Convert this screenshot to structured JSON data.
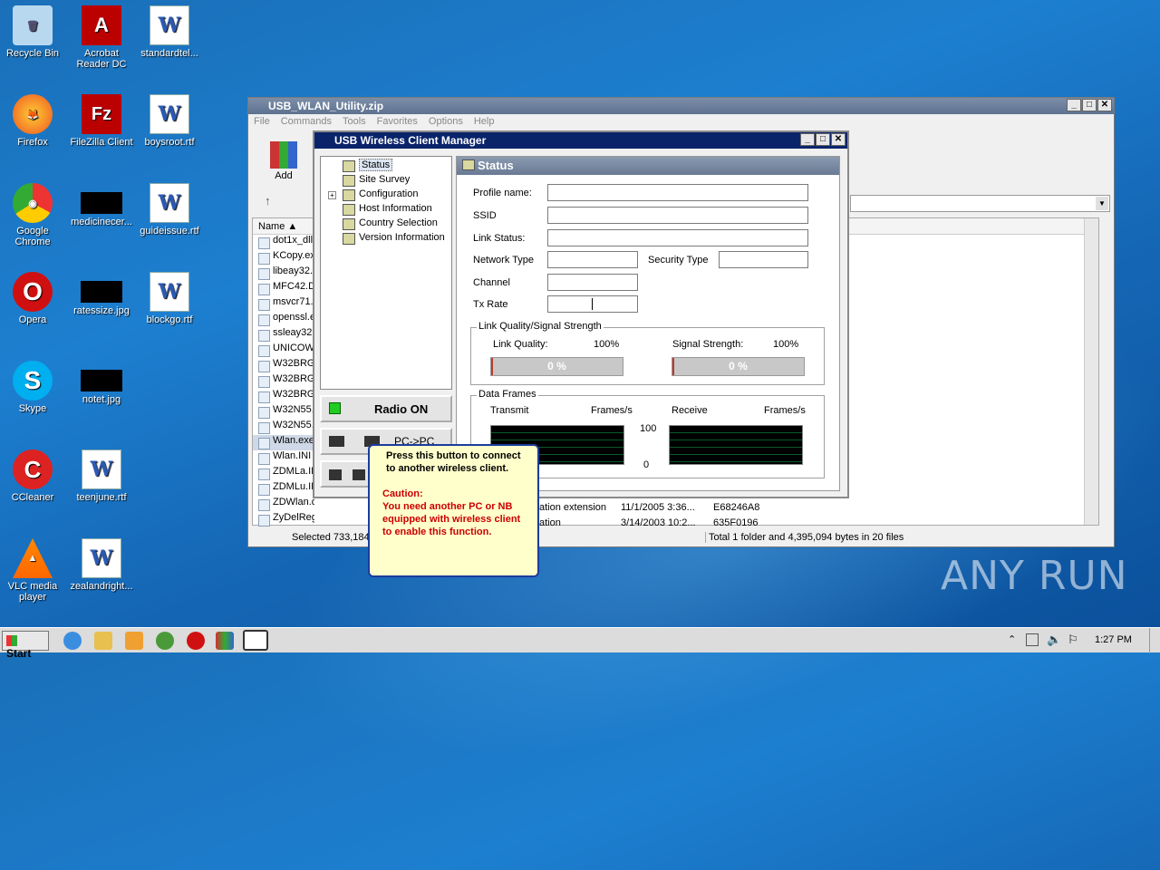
{
  "desktop": {
    "icons": [
      {
        "label": "Recycle Bin",
        "glyph": "🗑"
      },
      {
        "label": "Acrobat Reader DC",
        "glyph": "A"
      },
      {
        "label": "standardtel...",
        "glyph": "W"
      },
      {
        "label": "Firefox",
        "glyph": "🦊"
      },
      {
        "label": "FileZilla Client",
        "glyph": "Fz"
      },
      {
        "label": "boysroot.rtf",
        "glyph": "W"
      },
      {
        "label": "Google Chrome",
        "glyph": "◉"
      },
      {
        "label": "medicinecer...",
        "glyph": ""
      },
      {
        "label": "guideissue.rtf",
        "glyph": "W"
      },
      {
        "label": "Opera",
        "glyph": "O"
      },
      {
        "label": "ratessize.jpg",
        "glyph": ""
      },
      {
        "label": "blockgo.rtf",
        "glyph": "W"
      },
      {
        "label": "Skype",
        "glyph": "S"
      },
      {
        "label": "notet.jpg",
        "glyph": ""
      },
      {
        "label": "CCleaner",
        "glyph": "C"
      },
      {
        "label": "teenjune.rtf",
        "glyph": "W"
      },
      {
        "label": "VLC media player",
        "glyph": "▲"
      },
      {
        "label": "zealandright...",
        "glyph": "W"
      }
    ]
  },
  "winrar": {
    "title": "USB_WLAN_Utility.zip",
    "menu": [
      "File",
      "Commands",
      "Tools",
      "Favorites",
      "Options",
      "Help"
    ],
    "add_label": "Add",
    "column_name": "Name",
    "files": [
      "dot1x_dll",
      "KCopy.ex",
      "libeay32.",
      "MFC42.D",
      "msvcr71.",
      "openssl.e",
      "ssleay32",
      "UNICOW",
      "W32BRG",
      "W32BRG",
      "W32BRG",
      "W32N55.",
      "W32N55.",
      "Wlan.exe",
      "Wlan.INI",
      "ZDMLa.IN",
      "ZDMLu.IN",
      "ZDWlan.dll",
      "ZyDelReg.exe"
    ],
    "visible_details": [
      {
        "type": "ation extension",
        "modified": "11/1/2005 3:36...",
        "crc": "E68246A8"
      },
      {
        "type": "ation",
        "modified": "3/14/2003 10:2...",
        "crc": "635F0196"
      }
    ],
    "status_left": "Selected 733,184",
    "status_right": "Total 1 folder and 4,395,094 bytes in 20 files"
  },
  "manager": {
    "title": "USB Wireless Client Manager",
    "tree": [
      "Status",
      "Site Survey",
      "Configuration",
      "Host Information",
      "Country Selection",
      "Version Information"
    ],
    "radio_label": "Radio ON",
    "pc_label": "PC->PC",
    "panel_title": "Status",
    "fields": {
      "profile": "Profile name:",
      "ssid": "SSID",
      "link": "Link Status:",
      "network": "Network Type",
      "security": "Security Type",
      "channel": "Channel",
      "txrate": "Tx Rate"
    },
    "quality": {
      "group": "Link Quality/Signal Strength",
      "lq_label": "Link Quality:",
      "lq_max": "100%",
      "ss_label": "Signal Strength:",
      "ss_max": "100%",
      "lq_value": "0 %",
      "ss_value": "0 %"
    },
    "frames": {
      "group": "Data Frames",
      "transmit": "Transmit",
      "frames1": "Frames/s",
      "receive": "Receive",
      "frames2": "Frames/s",
      "max": "100",
      "min": "0"
    }
  },
  "tooltip": {
    "line1": "Press this button to connect to another wireless client.",
    "caution_title": "Caution:",
    "caution_body": "You need another PC or NB equipped with wireless client to enable this function."
  },
  "watermark": "ANY RUN",
  "taskbar": {
    "start": "Start",
    "time": "1:27 PM"
  }
}
